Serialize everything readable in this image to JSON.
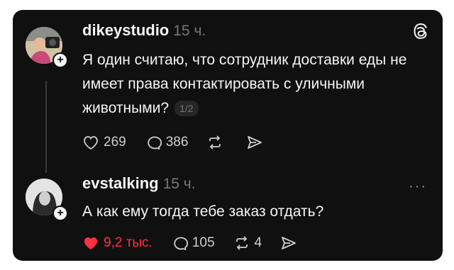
{
  "post1": {
    "username": "dikeystudio",
    "time": "15 ч.",
    "text": "Я один считаю, что сотрудник доставки еды не имеет права контактировать с уличными животными?",
    "pager": "1/2",
    "likes": "269",
    "replies": "386"
  },
  "post2": {
    "username": "evstalking",
    "time": "15 ч.",
    "text": "А как ему тогда тебе заказ отдать?",
    "likes": "9,2 тыс.",
    "replies": "105",
    "reposts": "4",
    "more": "···"
  },
  "icons": {
    "threads_logo": "threads-logo-icon",
    "plus": "+"
  },
  "colors": {
    "background": "#101010",
    "text": "#f3f5f7",
    "muted": "#777777",
    "like": "#ff3040"
  }
}
